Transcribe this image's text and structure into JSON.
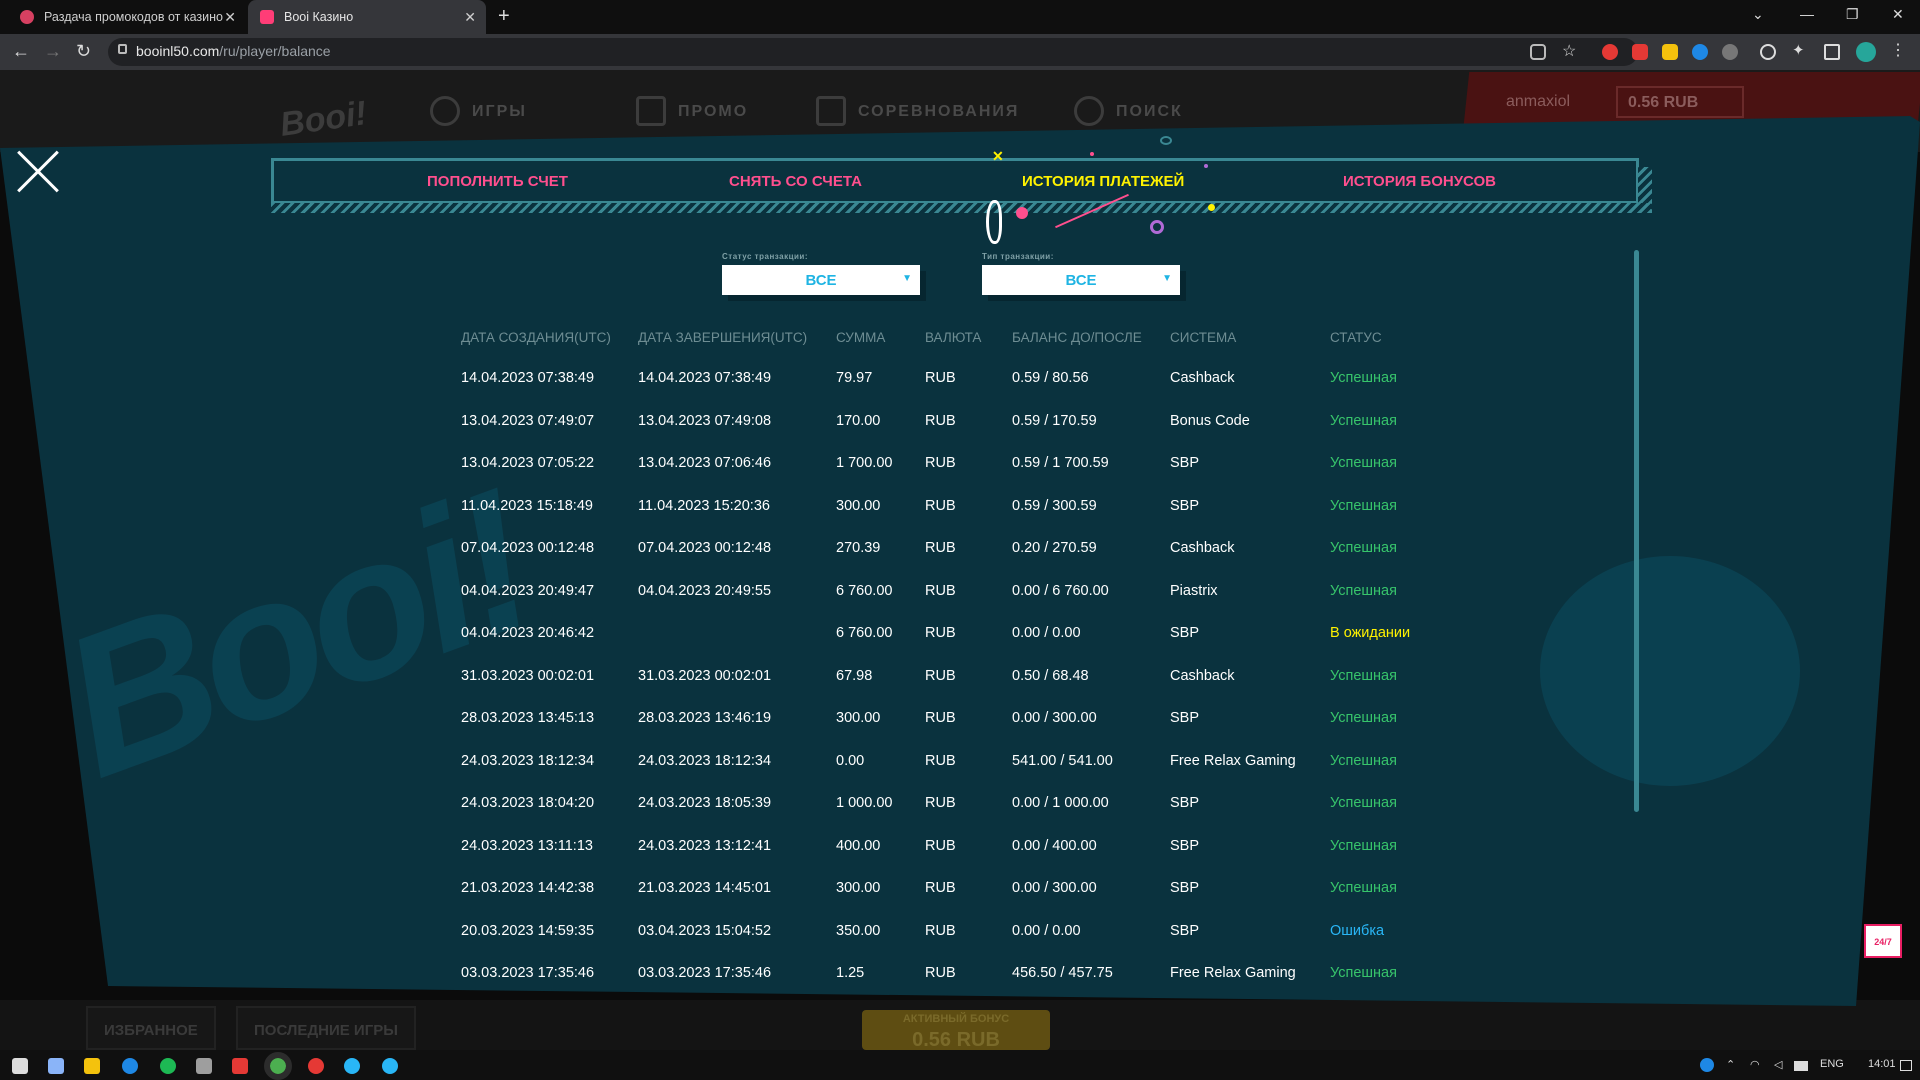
{
  "browser": {
    "tabs": [
      {
        "title": "Раздача промокодов от казино"
      },
      {
        "title": "Booi Казино"
      }
    ],
    "url_host": "booinl50.com",
    "url_path": "/ru/player/balance"
  },
  "site": {
    "logo": "Booi!",
    "nav": [
      "ИГРЫ",
      "ПРОМО",
      "СОРЕВНОВАНИЯ",
      "ПОИСК"
    ],
    "username": "anmaxiol",
    "balance": "0.56 RUB",
    "bottom_buttons": [
      "ИЗБРАННОЕ",
      "ПОСЛЕДНИЕ ИГРЫ"
    ],
    "bonus_label": "АКТИВНЫЙ БОНУС",
    "bonus_value": "0.56 RUB"
  },
  "modal": {
    "tabs": [
      "ПОПОЛНИТЬ СЧЕТ",
      "СНЯТЬ СО СЧЕТА",
      "ИСТОРИЯ ПЛАТЕЖЕЙ",
      "ИСТОРИЯ БОНУСОВ"
    ],
    "active_tab": 2,
    "filters": {
      "status_label": "Статус транзакции:",
      "status_value": "ВСЕ",
      "type_label": "Тип транзакции:",
      "type_value": "ВСЕ"
    },
    "columns": [
      "ДАТА СОЗДАНИЯ(UTC)",
      "ДАТА ЗАВЕРШЕНИЯ(UTC)",
      "СУММА",
      "ВАЛЮТА",
      "БАЛАНС ДО/ПОСЛЕ",
      "СИСТЕМА",
      "СТАТУС"
    ],
    "rows": [
      {
        "created": "14.04.2023 07:38:49",
        "completed": "14.04.2023 07:38:49",
        "amount": "79.97",
        "currency": "RUB",
        "balance": "0.59 / 80.56",
        "system": "Cashback",
        "status": "Успешная"
      },
      {
        "created": "13.04.2023 07:49:07",
        "completed": "13.04.2023 07:49:08",
        "amount": "170.00",
        "currency": "RUB",
        "balance": "0.59 / 170.59",
        "system": "Bonus Code",
        "status": "Успешная"
      },
      {
        "created": "13.04.2023 07:05:22",
        "completed": "13.04.2023 07:06:46",
        "amount": "1 700.00",
        "currency": "RUB",
        "balance": "0.59 / 1 700.59",
        "system": "SBP",
        "status": "Успешная"
      },
      {
        "created": "11.04.2023 15:18:49",
        "completed": "11.04.2023 15:20:36",
        "amount": "300.00",
        "currency": "RUB",
        "balance": "0.59 / 300.59",
        "system": "SBP",
        "status": "Успешная"
      },
      {
        "created": "07.04.2023 00:12:48",
        "completed": "07.04.2023 00:12:48",
        "amount": "270.39",
        "currency": "RUB",
        "balance": "0.20 / 270.59",
        "system": "Cashback",
        "status": "Успешная"
      },
      {
        "created": "04.04.2023 20:49:47",
        "completed": "04.04.2023 20:49:55",
        "amount": "6 760.00",
        "currency": "RUB",
        "balance": "0.00 / 6 760.00",
        "system": "Piastrix",
        "status": "Успешная"
      },
      {
        "created": "04.04.2023 20:46:42",
        "completed": "",
        "amount": "6 760.00",
        "currency": "RUB",
        "balance": "0.00 / 0.00",
        "system": "SBP",
        "status": "В ожидании"
      },
      {
        "created": "31.03.2023 00:02:01",
        "completed": "31.03.2023 00:02:01",
        "amount": "67.98",
        "currency": "RUB",
        "balance": "0.50 / 68.48",
        "system": "Cashback",
        "status": "Успешная"
      },
      {
        "created": "28.03.2023 13:45:13",
        "completed": "28.03.2023 13:46:19",
        "amount": "300.00",
        "currency": "RUB",
        "balance": "0.00 / 300.00",
        "system": "SBP",
        "status": "Успешная"
      },
      {
        "created": "24.03.2023 18:12:34",
        "completed": "24.03.2023 18:12:34",
        "amount": "0.00",
        "currency": "RUB",
        "balance": "541.00 / 541.00",
        "system": "Free Relax Gaming",
        "status": "Успешная"
      },
      {
        "created": "24.03.2023 18:04:20",
        "completed": "24.03.2023 18:05:39",
        "amount": "1 000.00",
        "currency": "RUB",
        "balance": "0.00 / 1 000.00",
        "system": "SBP",
        "status": "Успешная"
      },
      {
        "created": "24.03.2023 13:11:13",
        "completed": "24.03.2023 13:12:41",
        "amount": "400.00",
        "currency": "RUB",
        "balance": "0.00 / 400.00",
        "system": "SBP",
        "status": "Успешная"
      },
      {
        "created": "21.03.2023 14:42:38",
        "completed": "21.03.2023 14:45:01",
        "amount": "300.00",
        "currency": "RUB",
        "balance": "0.00 / 300.00",
        "system": "SBP",
        "status": "Успешная"
      },
      {
        "created": "20.03.2023 14:59:35",
        "completed": "03.04.2023 15:04:52",
        "amount": "350.00",
        "currency": "RUB",
        "balance": "0.00 / 0.00",
        "system": "SBP",
        "status": "Ошибка"
      },
      {
        "created": "03.03.2023 17:35:46",
        "completed": "03.03.2023 17:35:46",
        "amount": "1.25",
        "currency": "RUB",
        "balance": "456.50 / 457.75",
        "system": "Free Relax Gaming",
        "status": "Успешная"
      }
    ],
    "support_label": "24/7"
  },
  "taskbar": {
    "lang": "ENG",
    "time": "14:01"
  },
  "colors": {
    "overlay": "#0a323e",
    "tab_inactive": "#ff4f8e",
    "tab_active": "#fff200",
    "status_success": "#37c46b",
    "status_pending": "#fff200",
    "status_error": "#29b6f6"
  }
}
